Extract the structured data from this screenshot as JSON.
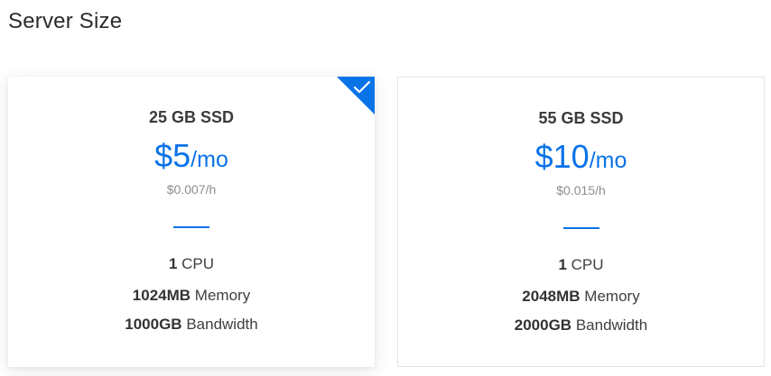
{
  "page": {
    "title": "Server Size"
  },
  "colors": {
    "accent": "#0a73e8",
    "selected_corner": "#0a73e8"
  },
  "plans": [
    {
      "disk": "25 GB SSD",
      "price_amount": "$5",
      "price_period": "/mo",
      "hourly": "$0.007/h",
      "cpu_value": "1",
      "cpu_label": "CPU",
      "memory_value": "1024MB",
      "memory_label": "Memory",
      "bandwidth_value": "1000GB",
      "bandwidth_label": "Bandwidth",
      "selected": true,
      "selected_icon": "checkmark-icon"
    },
    {
      "disk": "55 GB SSD",
      "price_amount": "$10",
      "price_period": "/mo",
      "hourly": "$0.015/h",
      "cpu_value": "1",
      "cpu_label": "CPU",
      "memory_value": "2048MB",
      "memory_label": "Memory",
      "bandwidth_value": "2000GB",
      "bandwidth_label": "Bandwidth",
      "selected": false
    }
  ]
}
